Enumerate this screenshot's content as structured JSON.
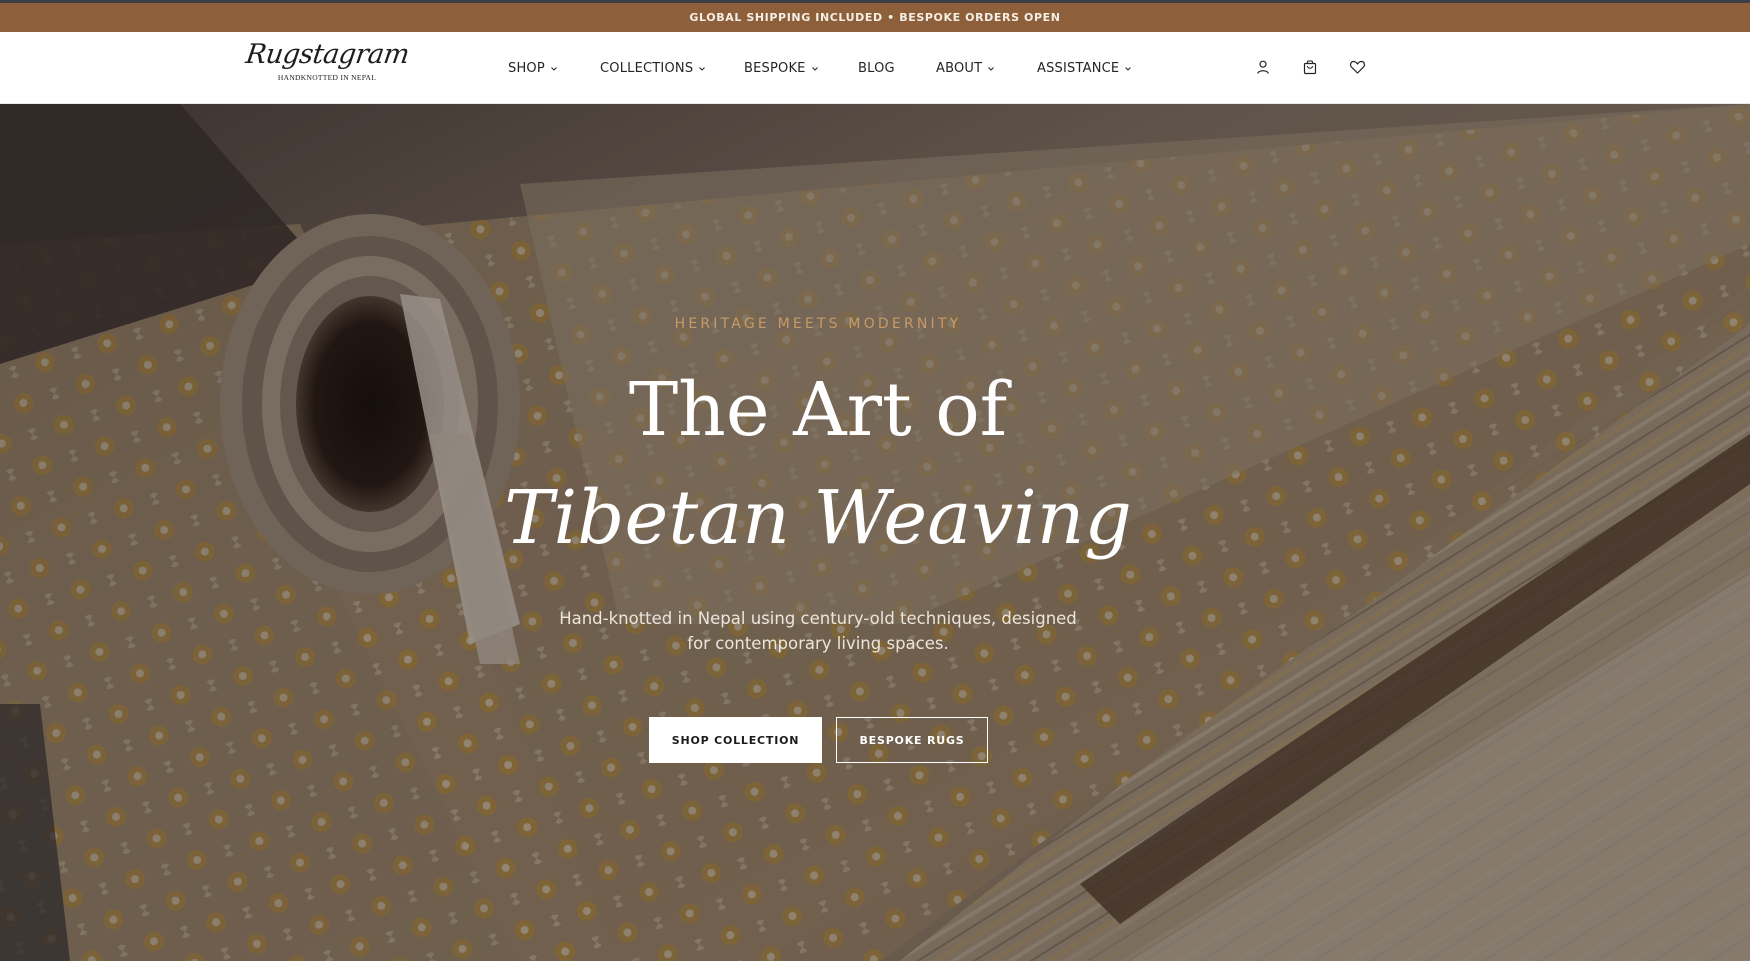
{
  "announcement": {
    "text": "GLOBAL SHIPPING INCLUDED • BESPOKE ORDERS OPEN"
  },
  "brand": {
    "name": "Rugstagram",
    "tagline": "HANDKNOTTED IN NEPAL"
  },
  "nav": {
    "items": [
      {
        "label": "SHOP",
        "has_dropdown": true
      },
      {
        "label": "COLLECTIONS",
        "has_dropdown": true
      },
      {
        "label": "BESPOKE",
        "has_dropdown": true
      },
      {
        "label": "BLOG",
        "has_dropdown": false
      },
      {
        "label": "ABOUT",
        "has_dropdown": true
      },
      {
        "label": "ASSISTANCE",
        "has_dropdown": true
      }
    ]
  },
  "header_icons": [
    "user-icon",
    "shopping-bag-icon",
    "heart-icon"
  ],
  "hero": {
    "eyebrow": "HERITAGE MEETS MODERNITY",
    "title_line1": "The Art of",
    "title_line2": "Tibetan Weaving",
    "subtitle": "Hand-knotted in Nepal using century-old techniques, designed for contemporary living spaces.",
    "primary_button": "SHOP COLLECTION",
    "secondary_button": "BESPOKE RUGS"
  },
  "colors": {
    "announcement_bg": "#8d5f3b",
    "accent": "#c89a66",
    "text_dark": "#262424"
  }
}
